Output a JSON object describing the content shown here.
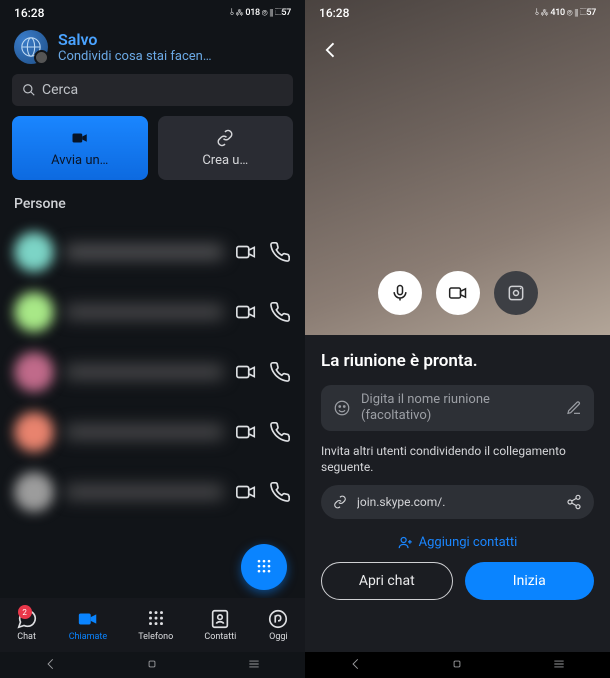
{
  "status": {
    "time": "16:28",
    "indicators_left": "⫰ ⁂ 018 ⦾ ⫴ ⬚57",
    "indicators_right": "⫰ ⁂ 410 ⦾ ⫴ ⬚57"
  },
  "left": {
    "profile_name": "Salvo",
    "profile_sub": "Condividi cosa stai facen…",
    "search_placeholder": "Cerca",
    "primary_btn": "Avvia un…",
    "secondary_btn": "Crea u…",
    "section": "Persone",
    "nav": {
      "chat": "Chat",
      "chat_badge": "2",
      "calls": "Chiamate",
      "phone": "Telefono",
      "contacts": "Contatti",
      "today": "Oggi"
    }
  },
  "right": {
    "sheet_title": "La riunione è pronta.",
    "name_placeholder_l1": "Digita il nome riunione",
    "name_placeholder_l2": "(facoltativo)",
    "invite_text": "Invita altri utenti condividendo il collegamento seguente.",
    "link": "join.skype.com/.",
    "add_contacts": "Aggiungi contatti",
    "open_chat": "Apri chat",
    "start": "Inizia"
  }
}
